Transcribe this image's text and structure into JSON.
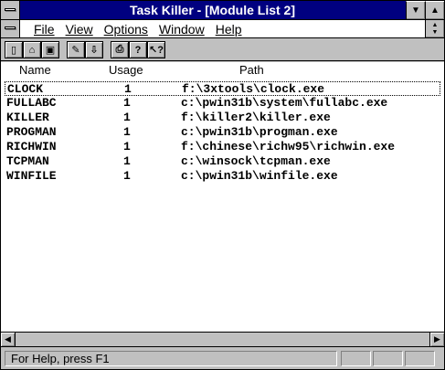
{
  "window": {
    "title": "Task Killer - [Module List 2]"
  },
  "menu": {
    "items": [
      {
        "label": "File"
      },
      {
        "label": "View"
      },
      {
        "label": "Options"
      },
      {
        "label": "Window"
      },
      {
        "label": "Help"
      }
    ]
  },
  "toolbar": {
    "buttons": [
      {
        "icon": "new-icon",
        "glyph": "▯"
      },
      {
        "icon": "open-icon",
        "glyph": "⌂"
      },
      {
        "icon": "save-icon",
        "glyph": "▣"
      },
      {
        "icon": "edit-icon",
        "glyph": "✎"
      },
      {
        "icon": "sort-icon",
        "glyph": "⇩"
      },
      {
        "icon": "print-icon",
        "glyph": "⎙"
      },
      {
        "icon": "help-icon",
        "glyph": "?"
      },
      {
        "icon": "context-help-icon",
        "glyph": "↖?"
      }
    ]
  },
  "columns": {
    "name": "Name",
    "usage": "Usage",
    "path": "Path"
  },
  "rows": [
    {
      "name": "CLOCK",
      "usage": "1",
      "path": "f:\\3xtools\\clock.exe"
    },
    {
      "name": "FULLABC",
      "usage": "1",
      "path": "c:\\pwin31b\\system\\fullabc.exe"
    },
    {
      "name": "KILLER",
      "usage": "1",
      "path": "f:\\killer2\\killer.exe"
    },
    {
      "name": "PROGMAN",
      "usage": "1",
      "path": "c:\\pwin31b\\progman.exe"
    },
    {
      "name": "RICHWIN",
      "usage": "1",
      "path": "f:\\chinese\\richw95\\richwin.exe"
    },
    {
      "name": "TCPMAN",
      "usage": "1",
      "path": "c:\\winsock\\tcpman.exe"
    },
    {
      "name": "WINFILE",
      "usage": "1",
      "path": "c:\\pwin31b\\winfile.exe"
    }
  ],
  "status": {
    "text": "For Help, press F1"
  },
  "colors": {
    "titlebar": "#000080",
    "face": "#c0c0c0",
    "window": "#ffffff"
  }
}
